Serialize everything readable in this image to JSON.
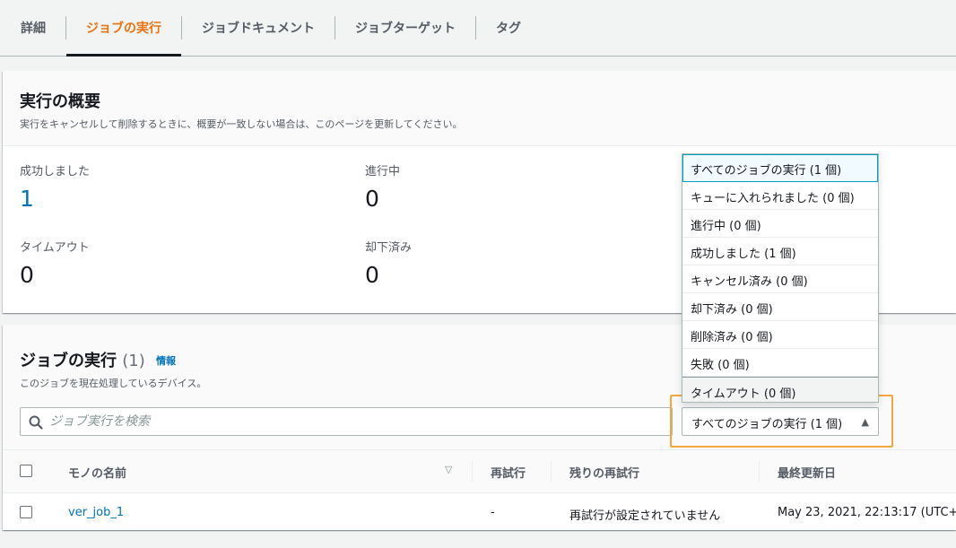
{
  "tabs": [
    {
      "label": "詳細"
    },
    {
      "label": "ジョブの実行"
    },
    {
      "label": "ジョブドキュメント"
    },
    {
      "label": "ジョブターゲット"
    },
    {
      "label": "タグ"
    }
  ],
  "summary": {
    "title": "実行の概要",
    "description": "実行をキャンセルして削除するときに、概要が一致しない場合は、このページを更新してください。",
    "stats": {
      "succeeded": {
        "label": "成功しました",
        "value": "1"
      },
      "in_progress": {
        "label": "進行中",
        "value": "0"
      },
      "timed_out": {
        "label": "タイムアウト",
        "value": "0"
      },
      "rejected": {
        "label": "却下済み",
        "value": "0"
      }
    }
  },
  "jobs": {
    "title": "ジョブの実行",
    "count": "(1)",
    "info": "情報",
    "description": "このジョブを現在処理しているデバイス。",
    "search_placeholder": "ジョブ実行を検索",
    "filter_value": "すべてのジョブの実行 (1 個)",
    "columns": {
      "name": "モノの名前",
      "retries": "再試行",
      "remaining": "残りの再試行",
      "updated": "最終更新日"
    },
    "rows": [
      {
        "name": "ver_job_1",
        "retries": "-",
        "remaining": "再試行が設定されていません",
        "updated": "May 23, 2021, 22:13:17 (UTC+0"
      }
    ]
  },
  "dropdown": {
    "options": [
      "すべてのジョブの実行 (1 個)",
      "キューに入れられました (0 個)",
      "進行中 (0 個)",
      "成功しました (1 個)",
      "キャンセル済み (0 個)",
      "却下済み (0 個)",
      "削除済み (0 個)",
      "失敗 (0 個)",
      "タイムアウト (0 個)"
    ]
  },
  "icons": {
    "search": "search-icon",
    "caret": "caret-up-icon",
    "sort": "sort-down-icon"
  },
  "colors": {
    "accent": "#ec7211",
    "link": "#0073bb",
    "highlight": "#f5a742"
  }
}
